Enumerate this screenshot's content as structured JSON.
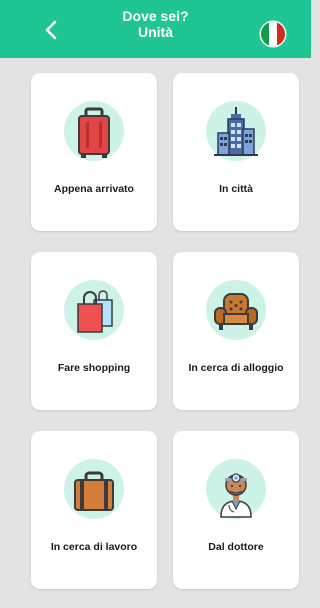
{
  "header": {
    "title_line1": "Dove sei?",
    "title_line2": "Unità",
    "back_icon": "chevron-left-icon",
    "flag_icon": "italian-flag-icon",
    "background_color": "#1fc694"
  },
  "cards": [
    {
      "label": "Appena arrivato",
      "icon": "suitcase-icon"
    },
    {
      "label": "In città",
      "icon": "city-building-icon"
    },
    {
      "label": "Fare shopping",
      "icon": "shopping-bag-icon"
    },
    {
      "label": "In cerca di alloggio",
      "icon": "armchair-icon"
    },
    {
      "label": "In cerca di lavoro",
      "icon": "briefcase-icon"
    },
    {
      "label": "Dal dottore",
      "icon": "doctor-icon"
    }
  ],
  "colors": {
    "accent": "#1fc694",
    "icon_background": "#cdf2e8",
    "page_background": "#e3e3e3"
  }
}
